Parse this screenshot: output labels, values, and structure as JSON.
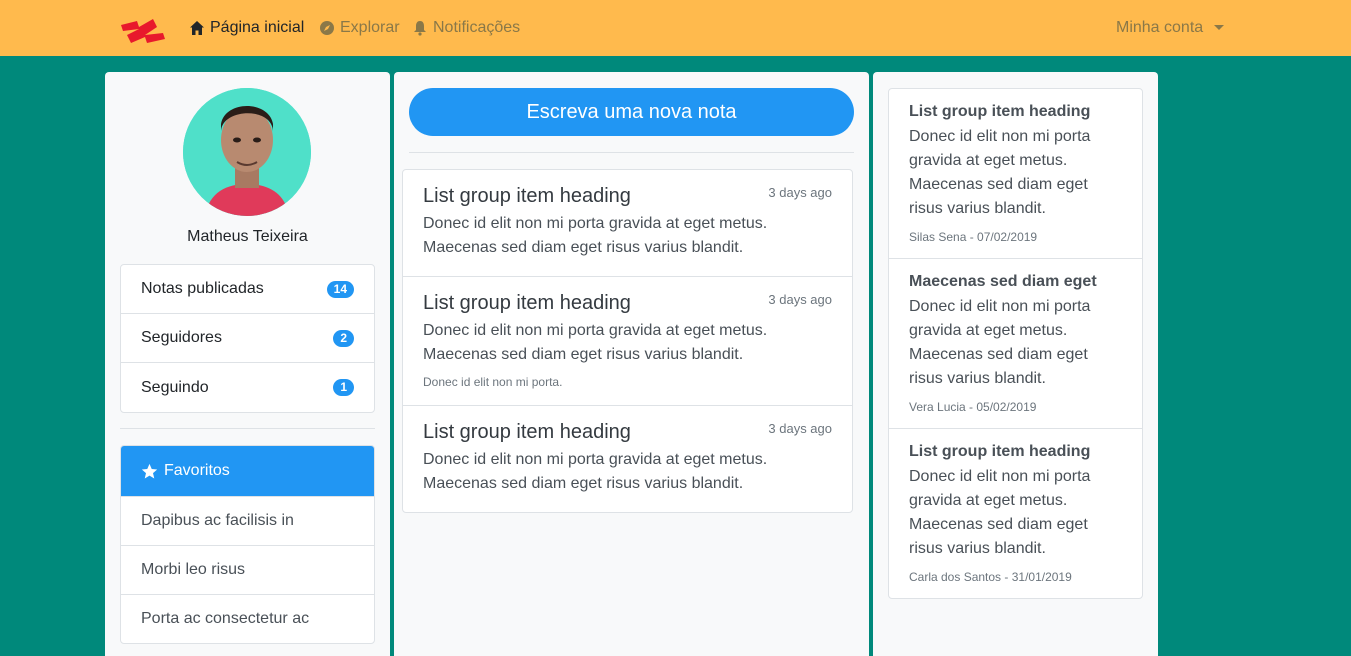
{
  "navbar": {
    "brand_icon": "red-zigzag-logo",
    "home": "Página inicial",
    "explore": "Explorar",
    "notifications": "Notificações",
    "account": "Minha conta"
  },
  "profile": {
    "name": "Matheus Teixeira",
    "stats": [
      {
        "label": "Notas publicadas",
        "count": "14"
      },
      {
        "label": "Seguidores",
        "count": "2"
      },
      {
        "label": "Seguindo",
        "count": "1"
      }
    ]
  },
  "favorites": {
    "title": "Favoritos",
    "items": [
      "Dapibus ac facilisis in",
      "Morbi leo risus",
      "Porta ac consectetur ac"
    ]
  },
  "compose": {
    "label": "Escreva uma nova nota"
  },
  "notes": [
    {
      "title": "List group item heading",
      "time": "3 days ago",
      "text": "Donec id elit non mi porta gravida at eget metus. Maecenas sed diam eget risus varius blandit.",
      "small": ""
    },
    {
      "title": "List group item heading",
      "time": "3 days ago",
      "text": "Donec id elit non mi porta gravida at eget metus. Maecenas sed diam eget risus varius blandit.",
      "small": "Donec id elit non mi porta."
    },
    {
      "title": "List group item heading",
      "time": "3 days ago",
      "text": "Donec id elit non mi porta gravida at eget metus. Maecenas sed diam eget risus varius blandit.",
      "small": ""
    }
  ],
  "sidebar_notes": [
    {
      "title": "List group item heading",
      "text": "Donec id elit non mi porta gravida at eget metus. Maecenas sed diam eget risus varius blandit.",
      "meta": "Silas Sena - 07/02/2019"
    },
    {
      "title": "Maecenas sed diam eget",
      "text": "Donec id elit non mi porta gravida at eget metus. Maecenas sed diam eget risus varius blandit.",
      "meta": "Vera Lucia - 05/02/2019"
    },
    {
      "title": "List group item heading",
      "text": "Donec id elit non mi porta gravida at eget metus. Maecenas sed diam eget risus varius blandit.",
      "meta": "Carla dos Santos - 31/01/2019"
    }
  ],
  "colors": {
    "navbar": "#ffba4d",
    "background": "#00897b",
    "accent": "#2196f3"
  }
}
